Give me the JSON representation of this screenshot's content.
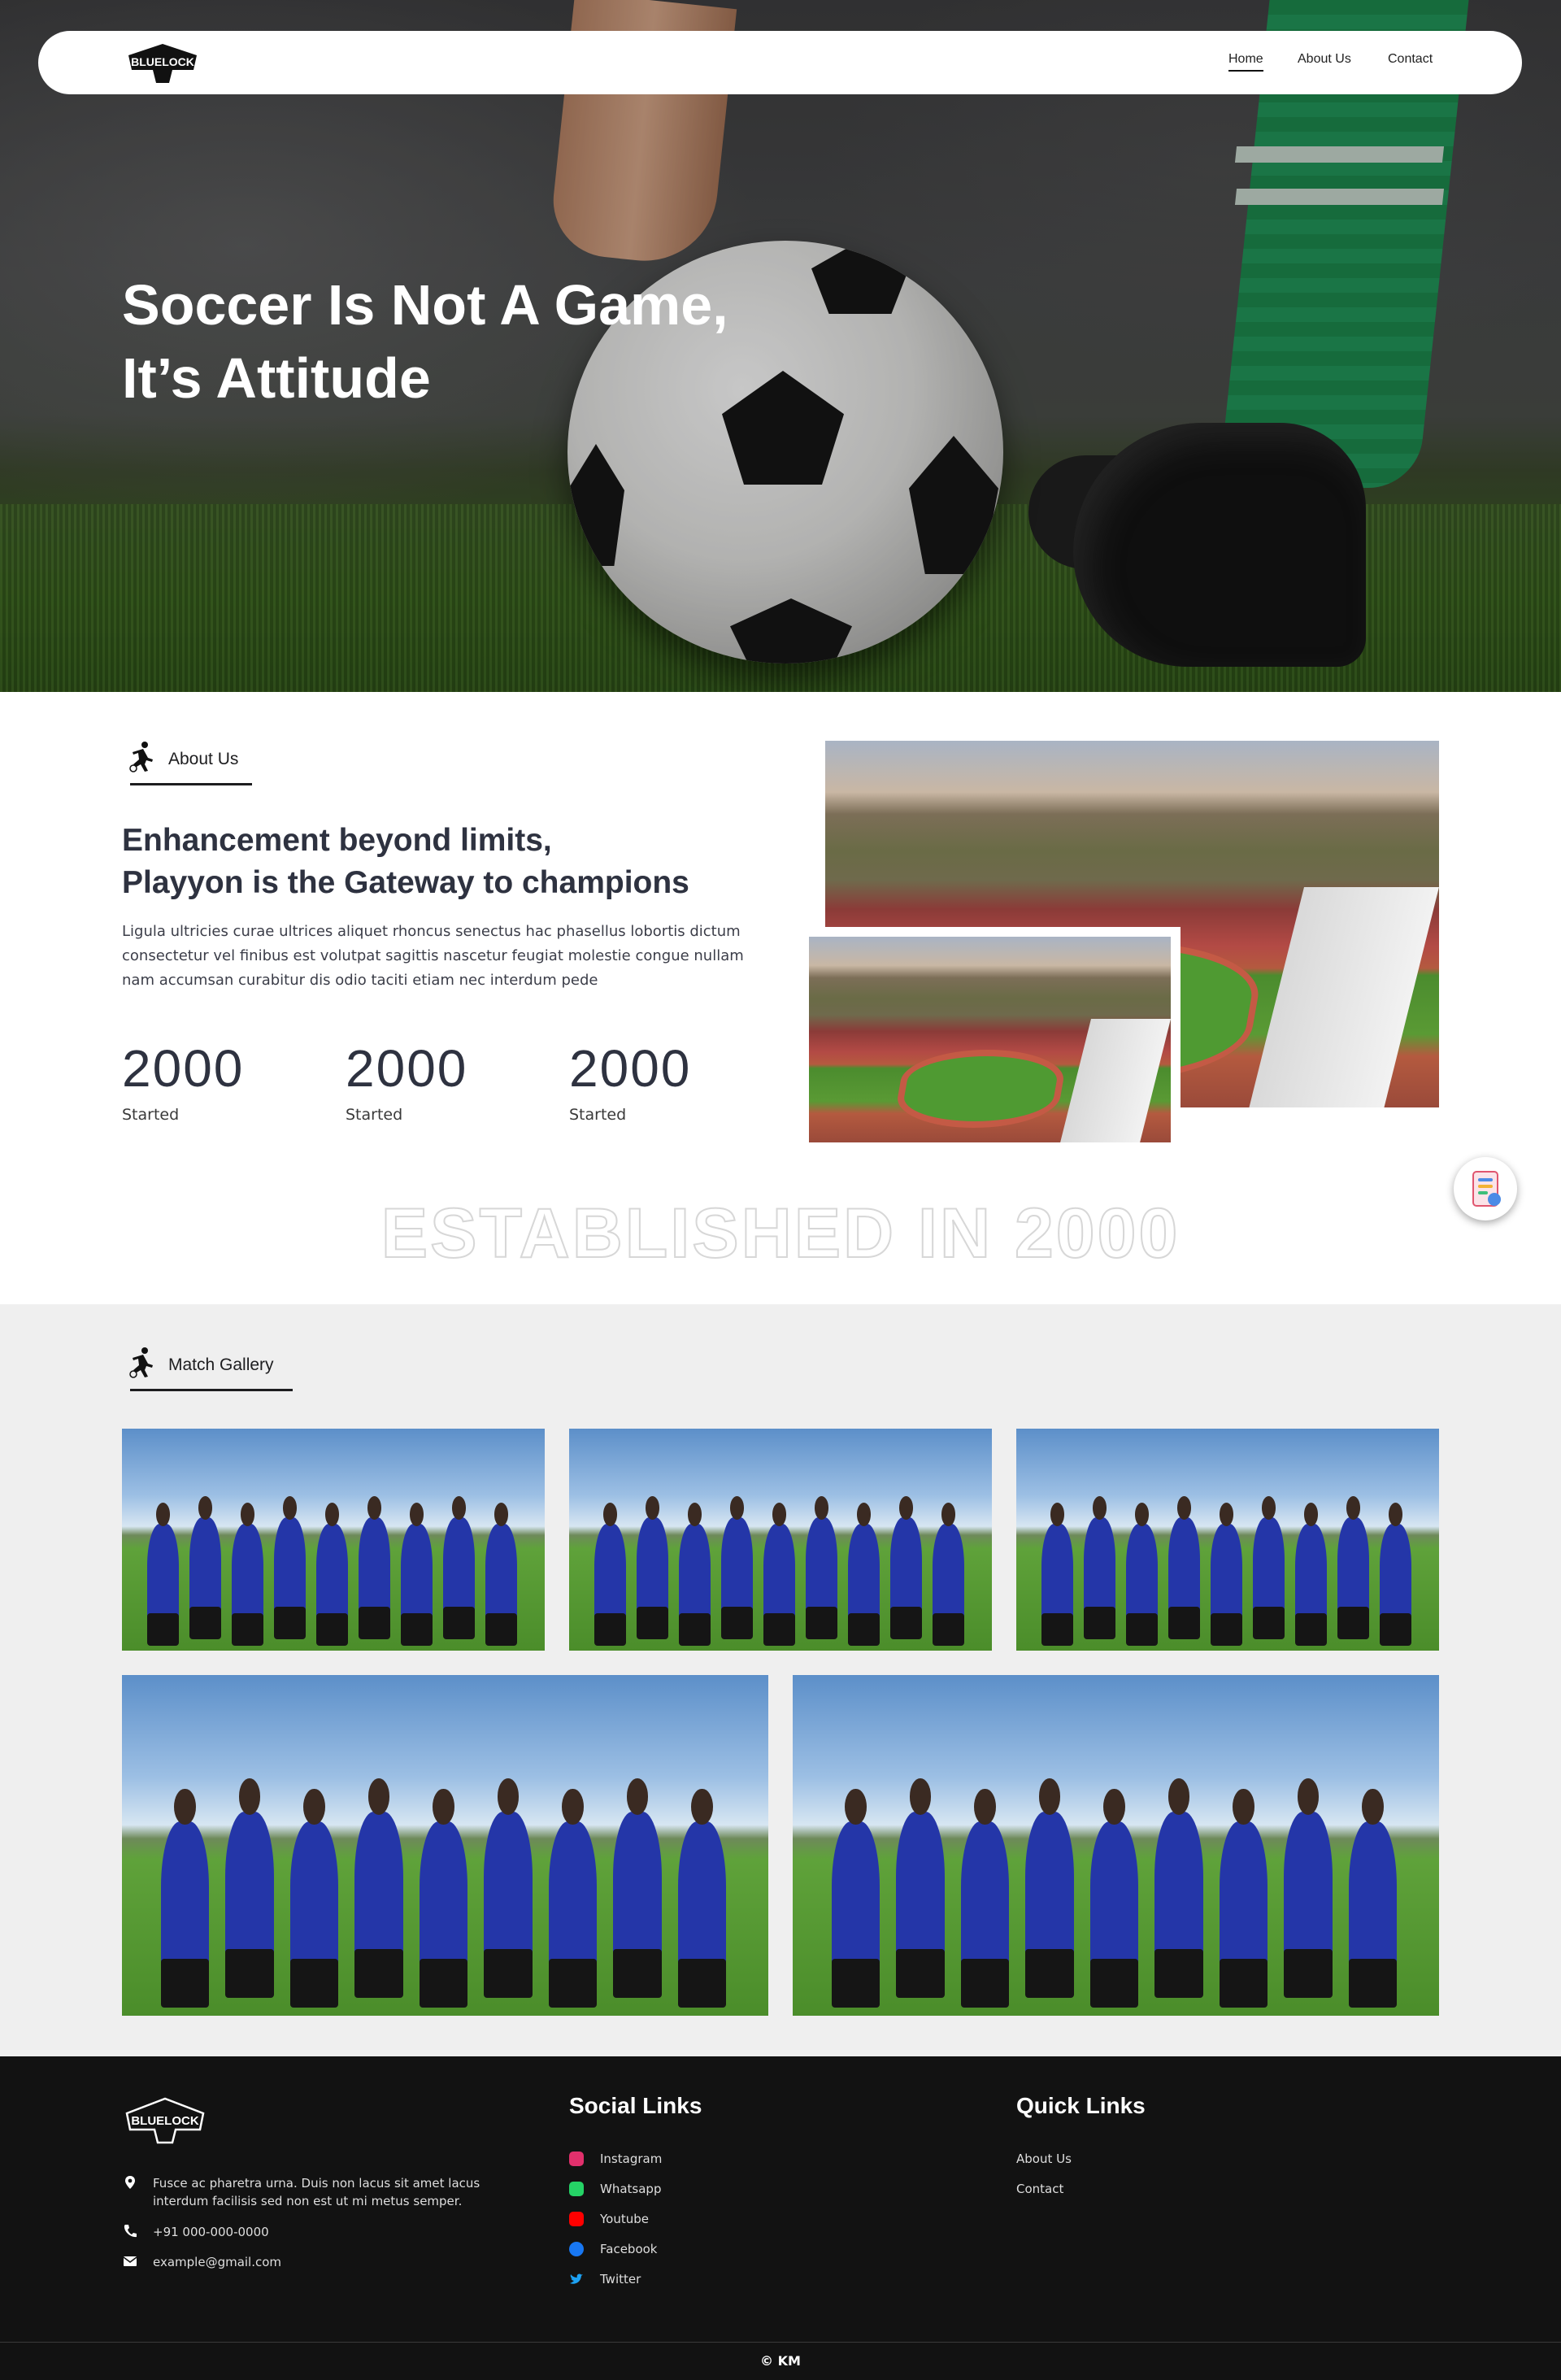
{
  "nav": {
    "logo_text": "BLUELOCK",
    "links": [
      {
        "label": "Home"
      },
      {
        "label": "About Us"
      },
      {
        "label": "Contact"
      }
    ]
  },
  "hero": {
    "title_line1": "Soccer Is Not A Game,",
    "title_line2": "It’s Attitude"
  },
  "about": {
    "tag": "About Us",
    "heading_line1": "Enhancement beyond limits,",
    "heading_line2": "Playyon is the Gateway to champions",
    "text": "Ligula ultricies curae ultrices aliquet rhoncus senectus hac phasellus lobortis dictum consectetur vel finibus est volutpat sagittis nascetur feugiat molestie congue nullam nam accumsan curabitur dis odio taciti etiam nec interdum pede",
    "stats": [
      {
        "value": "2000",
        "label": "Started"
      },
      {
        "value": "2000",
        "label": "Started"
      },
      {
        "value": "2000",
        "label": "Started"
      }
    ],
    "established": "ESTABLISHED IN 2000"
  },
  "gallery": {
    "tag": "Match Gallery",
    "images_count": 5
  },
  "footer": {
    "logo_text": "BLUELOCK",
    "address": "Fusce ac pharetra urna. Duis non lacus sit amet lacus interdum facilisis sed non est ut mi metus semper.",
    "phone": "+91 000-000-0000",
    "email": "example@gmail.com",
    "social_title": "Social Links",
    "social": [
      {
        "label": "Instagram",
        "color": "#e1306c"
      },
      {
        "label": "Whatsapp",
        "color": "#25d366"
      },
      {
        "label": "Youtube",
        "color": "#ff0000"
      },
      {
        "label": "Facebook",
        "color": "#1877f2"
      },
      {
        "label": "Twitter",
        "color": "#1da1f2"
      }
    ],
    "quick_title": "Quick Links",
    "quick": [
      {
        "label": "About Us"
      },
      {
        "label": "Contact"
      }
    ],
    "copyright": "© KM"
  }
}
